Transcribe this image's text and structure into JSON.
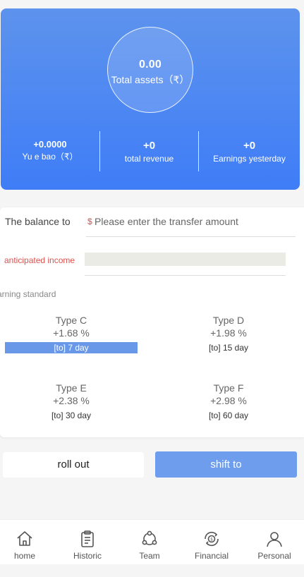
{
  "summary": {
    "total_assets_value": "0.00",
    "total_assets_label": "Total assets（₹）",
    "yuebao_value": "+0.0000",
    "yuebao_label": "Yu e bao（₹）",
    "total_revenue_value": "+0",
    "total_revenue_label": "total revenue",
    "earnings_yesterday_value": "+0",
    "earnings_yesterday_label": "Earnings yesterday"
  },
  "form": {
    "balance_label": "The balance to",
    "currency_symbol": "$",
    "amount_placeholder": "Please enter the transfer amount",
    "income_label": "anticipated income",
    "earning_standard_label": "arning standard"
  },
  "plans": [
    {
      "name": "Type C",
      "rate": "+1.68 %",
      "days": "[to] 7 day",
      "selected": true
    },
    {
      "name": "Type D",
      "rate": "+1.98 %",
      "days": "[to] 15 day",
      "selected": false
    },
    {
      "name": "Type E",
      "rate": "+2.38 %",
      "days": "[to] 30 day",
      "selected": false
    },
    {
      "name": "Type F",
      "rate": "+2.98 %",
      "days": "[to] 60 day",
      "selected": false
    }
  ],
  "actions": {
    "roll_out_label": "roll out",
    "shift_to_label": "shift to"
  },
  "nav": [
    {
      "label": "home",
      "icon": "home-icon"
    },
    {
      "label": "Historic",
      "icon": "clipboard-icon"
    },
    {
      "label": "Team",
      "icon": "team-icon"
    },
    {
      "label": "Financial",
      "icon": "financial-icon"
    },
    {
      "label": "Personal",
      "icon": "person-icon"
    }
  ],
  "colors": {
    "card_gradient_top": "#5d93ed",
    "card_gradient_bottom": "#3f7df7",
    "primary_button": "#6e9ded",
    "selected_plan": "#6a98e8",
    "warning_text": "#d9534f"
  }
}
